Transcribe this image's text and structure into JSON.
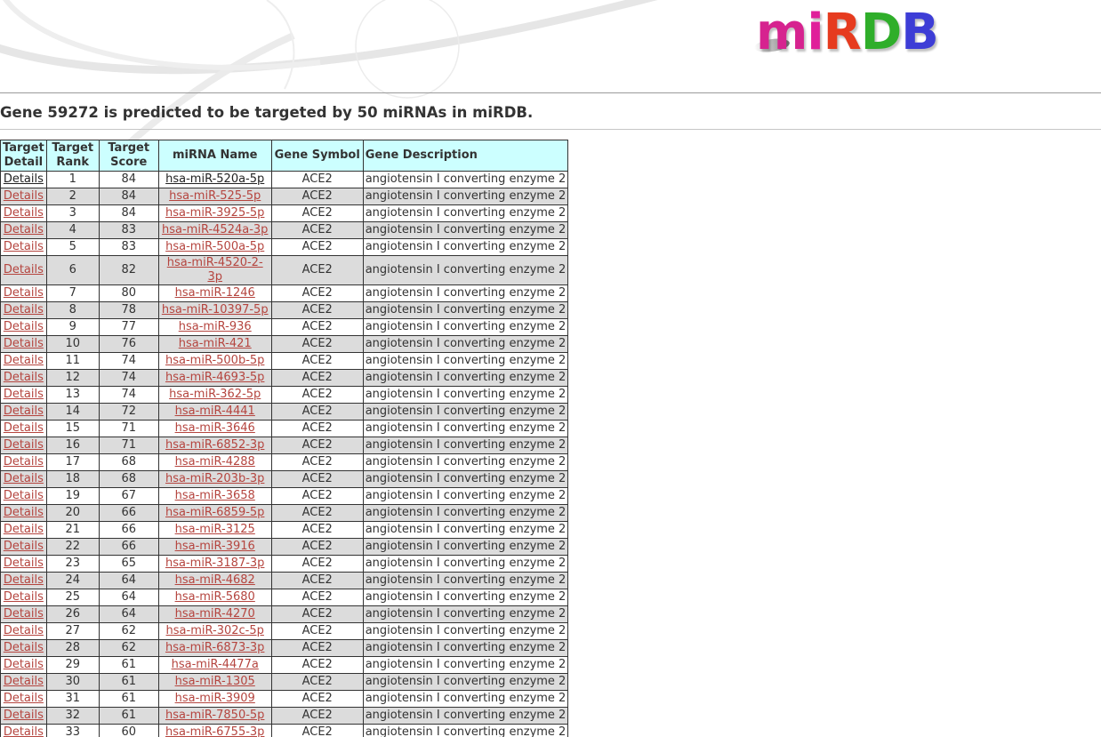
{
  "site": {
    "logo": "miRDB"
  },
  "headline": "Gene 59272 is predicted to be targeted by 50 miRNAs in miRDB.",
  "table": {
    "headers": {
      "detail": "Target Detail",
      "rank": "Target Rank",
      "score": "Target Score",
      "mirna": "miRNA Name",
      "symbol": "Gene Symbol",
      "description": "Gene Description"
    },
    "rows": [
      {
        "detail": "Details",
        "rank": "1",
        "score": "84",
        "mirna": "hsa-miR-520a-5p",
        "symbol": "ACE2",
        "description": "angiotensin I converting enzyme 2"
      },
      {
        "detail": "Details",
        "rank": "2",
        "score": "84",
        "mirna": "hsa-miR-525-5p",
        "symbol": "ACE2",
        "description": "angiotensin I converting enzyme 2"
      },
      {
        "detail": "Details",
        "rank": "3",
        "score": "84",
        "mirna": "hsa-miR-3925-5p",
        "symbol": "ACE2",
        "description": "angiotensin I converting enzyme 2"
      },
      {
        "detail": "Details",
        "rank": "4",
        "score": "83",
        "mirna": "hsa-miR-4524a-3p",
        "symbol": "ACE2",
        "description": "angiotensin I converting enzyme 2"
      },
      {
        "detail": "Details",
        "rank": "5",
        "score": "83",
        "mirna": "hsa-miR-500a-5p",
        "symbol": "ACE2",
        "description": "angiotensin I converting enzyme 2"
      },
      {
        "detail": "Details",
        "rank": "6",
        "score": "82",
        "mirna": "hsa-miR-4520-2-3p",
        "symbol": "ACE2",
        "description": "angiotensin I converting enzyme 2"
      },
      {
        "detail": "Details",
        "rank": "7",
        "score": "80",
        "mirna": "hsa-miR-1246",
        "symbol": "ACE2",
        "description": "angiotensin I converting enzyme 2"
      },
      {
        "detail": "Details",
        "rank": "8",
        "score": "78",
        "mirna": "hsa-miR-10397-5p",
        "symbol": "ACE2",
        "description": "angiotensin I converting enzyme 2"
      },
      {
        "detail": "Details",
        "rank": "9",
        "score": "77",
        "mirna": "hsa-miR-936",
        "symbol": "ACE2",
        "description": "angiotensin I converting enzyme 2"
      },
      {
        "detail": "Details",
        "rank": "10",
        "score": "76",
        "mirna": "hsa-miR-421",
        "symbol": "ACE2",
        "description": "angiotensin I converting enzyme 2"
      },
      {
        "detail": "Details",
        "rank": "11",
        "score": "74",
        "mirna": "hsa-miR-500b-5p",
        "symbol": "ACE2",
        "description": "angiotensin I converting enzyme 2"
      },
      {
        "detail": "Details",
        "rank": "12",
        "score": "74",
        "mirna": "hsa-miR-4693-5p",
        "symbol": "ACE2",
        "description": "angiotensin I converting enzyme 2"
      },
      {
        "detail": "Details",
        "rank": "13",
        "score": "74",
        "mirna": "hsa-miR-362-5p",
        "symbol": "ACE2",
        "description": "angiotensin I converting enzyme 2"
      },
      {
        "detail": "Details",
        "rank": "14",
        "score": "72",
        "mirna": "hsa-miR-4441",
        "symbol": "ACE2",
        "description": "angiotensin I converting enzyme 2"
      },
      {
        "detail": "Details",
        "rank": "15",
        "score": "71",
        "mirna": "hsa-miR-3646",
        "symbol": "ACE2",
        "description": "angiotensin I converting enzyme 2"
      },
      {
        "detail": "Details",
        "rank": "16",
        "score": "71",
        "mirna": "hsa-miR-6852-3p",
        "symbol": "ACE2",
        "description": "angiotensin I converting enzyme 2"
      },
      {
        "detail": "Details",
        "rank": "17",
        "score": "68",
        "mirna": "hsa-miR-4288",
        "symbol": "ACE2",
        "description": "angiotensin I converting enzyme 2"
      },
      {
        "detail": "Details",
        "rank": "18",
        "score": "68",
        "mirna": "hsa-miR-203b-3p",
        "symbol": "ACE2",
        "description": "angiotensin I converting enzyme 2"
      },
      {
        "detail": "Details",
        "rank": "19",
        "score": "67",
        "mirna": "hsa-miR-3658",
        "symbol": "ACE2",
        "description": "angiotensin I converting enzyme 2"
      },
      {
        "detail": "Details",
        "rank": "20",
        "score": "66",
        "mirna": "hsa-miR-6859-5p",
        "symbol": "ACE2",
        "description": "angiotensin I converting enzyme 2"
      },
      {
        "detail": "Details",
        "rank": "21",
        "score": "66",
        "mirna": "hsa-miR-3125",
        "symbol": "ACE2",
        "description": "angiotensin I converting enzyme 2"
      },
      {
        "detail": "Details",
        "rank": "22",
        "score": "66",
        "mirna": "hsa-miR-3916",
        "symbol": "ACE2",
        "description": "angiotensin I converting enzyme 2"
      },
      {
        "detail": "Details",
        "rank": "23",
        "score": "65",
        "mirna": "hsa-miR-3187-3p",
        "symbol": "ACE2",
        "description": "angiotensin I converting enzyme 2"
      },
      {
        "detail": "Details",
        "rank": "24",
        "score": "64",
        "mirna": "hsa-miR-4682",
        "symbol": "ACE2",
        "description": "angiotensin I converting enzyme 2"
      },
      {
        "detail": "Details",
        "rank": "25",
        "score": "64",
        "mirna": "hsa-miR-5680",
        "symbol": "ACE2",
        "description": "angiotensin I converting enzyme 2"
      },
      {
        "detail": "Details",
        "rank": "26",
        "score": "64",
        "mirna": "hsa-miR-4270",
        "symbol": "ACE2",
        "description": "angiotensin I converting enzyme 2"
      },
      {
        "detail": "Details",
        "rank": "27",
        "score": "62",
        "mirna": "hsa-miR-302c-5p",
        "symbol": "ACE2",
        "description": "angiotensin I converting enzyme 2"
      },
      {
        "detail": "Details",
        "rank": "28",
        "score": "62",
        "mirna": "hsa-miR-6873-3p",
        "symbol": "ACE2",
        "description": "angiotensin I converting enzyme 2"
      },
      {
        "detail": "Details",
        "rank": "29",
        "score": "61",
        "mirna": "hsa-miR-4477a",
        "symbol": "ACE2",
        "description": "angiotensin I converting enzyme 2"
      },
      {
        "detail": "Details",
        "rank": "30",
        "score": "61",
        "mirna": "hsa-miR-1305",
        "symbol": "ACE2",
        "description": "angiotensin I converting enzyme 2"
      },
      {
        "detail": "Details",
        "rank": "31",
        "score": "61",
        "mirna": "hsa-miR-3909",
        "symbol": "ACE2",
        "description": "angiotensin I converting enzyme 2"
      },
      {
        "detail": "Details",
        "rank": "32",
        "score": "61",
        "mirna": "hsa-miR-7850-5p",
        "symbol": "ACE2",
        "description": "angiotensin I converting enzyme 2"
      },
      {
        "detail": "Details",
        "rank": "33",
        "score": "60",
        "mirna": "hsa-miR-6755-3p",
        "symbol": "ACE2",
        "description": "angiotensin I converting enzyme 2"
      }
    ]
  },
  "colors": {
    "header_bg": "#ccffff",
    "row_alt_bg": "#dcdcdc",
    "link": "#b5453f"
  }
}
